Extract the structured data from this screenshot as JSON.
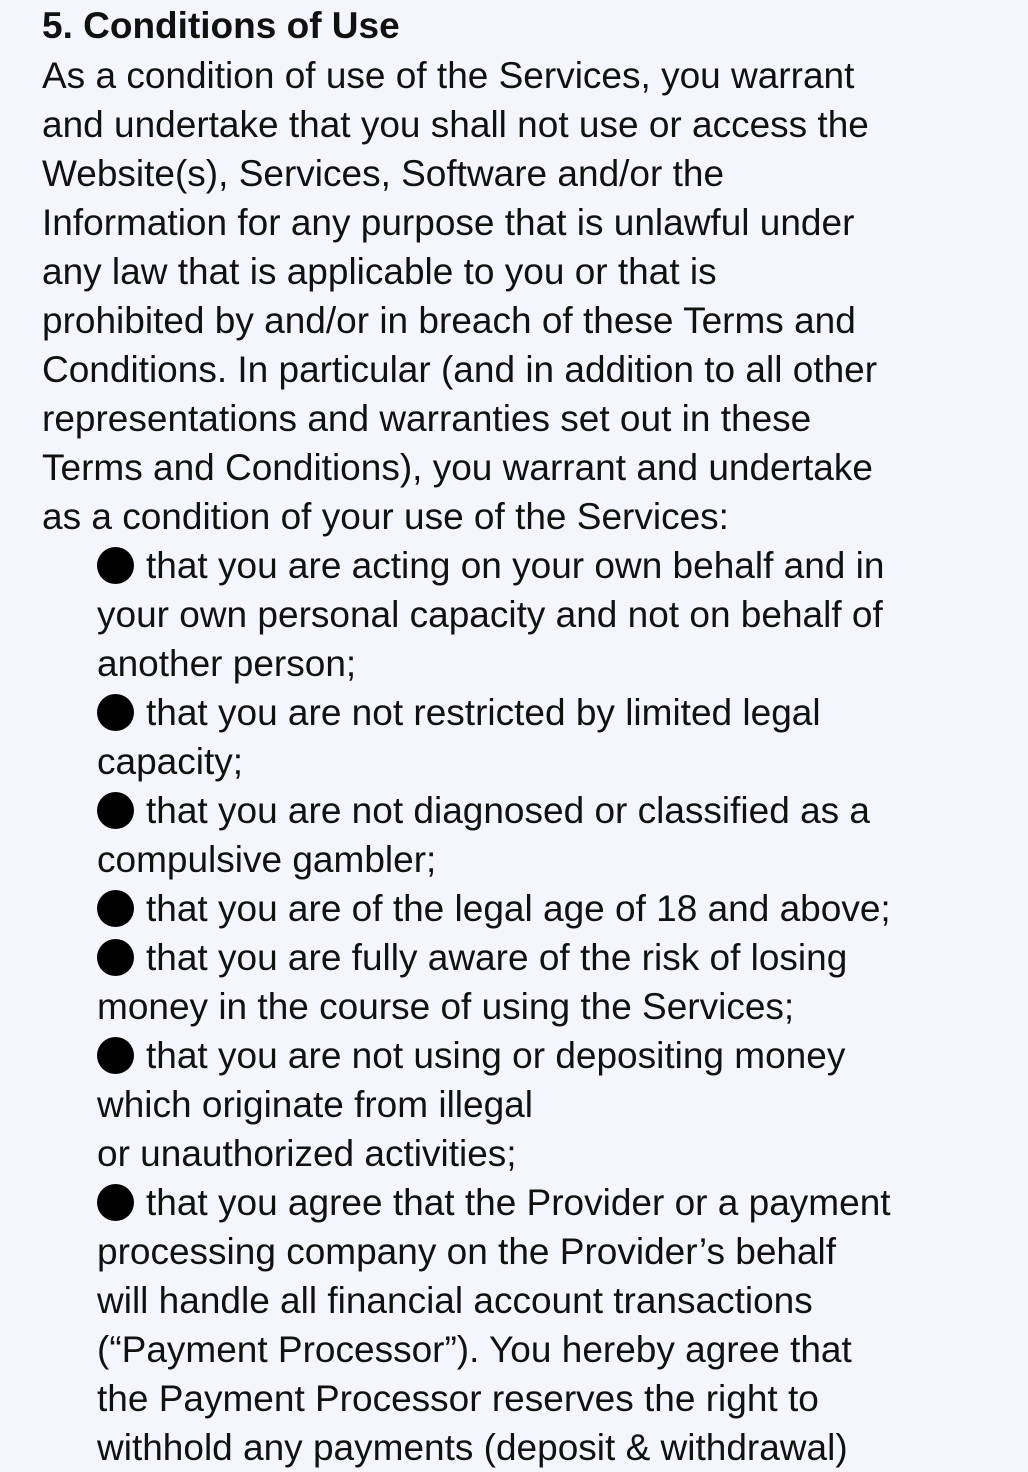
{
  "section": {
    "heading": "5. Conditions of Use",
    "intro_lines": [
      "As a condition of use of the Services, you warrant",
      "and undertake that you shall not use or access the",
      "Website(s), Services, Software and/or the",
      "Information for any purpose that is unlawful under",
      "any law that is applicable to you or that is",
      "prohibited by and/or in breach of these Terms and",
      "Conditions. In particular (and in addition to all other",
      "representations and warranties set out in these",
      "Terms and Conditions), you warrant and undertake",
      "as a condition of your use of the Services:"
    ],
    "bullets": [
      {
        "lines": [
          "that you are acting on your own behalf and in",
          "your own personal capacity and not on behalf of",
          "another person;"
        ]
      },
      {
        "lines": [
          "that you are not restricted by limited legal",
          "capacity;"
        ]
      },
      {
        "lines": [
          "that you are not diagnosed or classified as a",
          "compulsive gambler;"
        ]
      },
      {
        "lines": [
          "that you are of the legal age of 18 and above;"
        ]
      },
      {
        "lines": [
          "that you are fully aware of the risk of losing",
          "money in the course of using the Services;"
        ]
      },
      {
        "lines": [
          "that you are not using or depositing money",
          "which originate from illegal",
          "or unauthorized activities;"
        ]
      },
      {
        "lines": [
          "that you agree that the Provider or a payment",
          "processing company on the Provider’s behalf",
          "will handle all financial account transactions",
          "(“Payment Processor”). You hereby agree that",
          "the Payment Processor reserves the right to",
          "withhold any payments (deposit & withdrawal)"
        ]
      }
    ]
  },
  "colors": {
    "background": "#f5f6fd",
    "text": "#111111",
    "bullet": "#000000"
  },
  "icons": {
    "bullet": "bullet-dot-icon"
  }
}
